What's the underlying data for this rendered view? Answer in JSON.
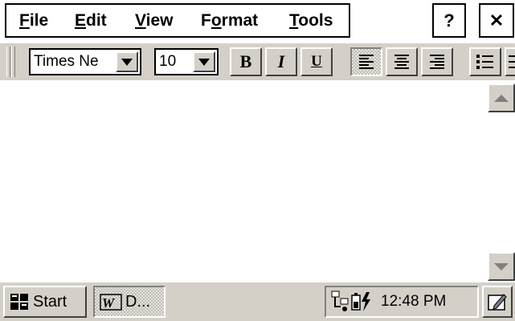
{
  "menu": {
    "file": {
      "pre": "",
      "u": "F",
      "post": "ile"
    },
    "edit": {
      "pre": "",
      "u": "E",
      "post": "dit"
    },
    "view": {
      "pre": "",
      "u": "V",
      "post": "iew"
    },
    "format": {
      "pre": "F",
      "u": "o",
      "post": "rmat"
    },
    "tools": {
      "pre": "",
      "u": "T",
      "post": "ools"
    },
    "help_label": "?",
    "close_label": "✕"
  },
  "toolbar": {
    "font_name": "Times Ne",
    "font_size": "10",
    "bold_label": "B",
    "italic_label": "I",
    "underline_label": "U",
    "align_selected": "left"
  },
  "document": {
    "text": ""
  },
  "taskbar": {
    "start_label": "Start",
    "task_label": "D...",
    "clock": "12:48 PM"
  },
  "colors": {
    "face": "#d4d0c8",
    "shadow": "#808080",
    "background": "#ffffff"
  }
}
